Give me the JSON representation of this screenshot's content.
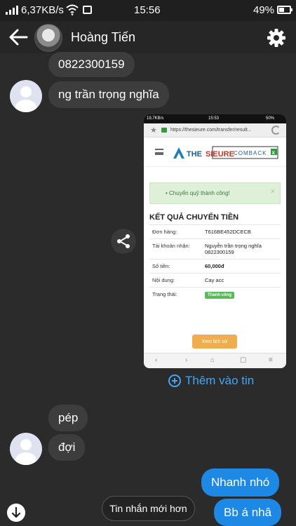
{
  "status_bar": {
    "speed": "6,37KB/s",
    "time": "15:56",
    "battery": "49%",
    "battery_level": 0.49
  },
  "header": {
    "title": "Hoàng Tiến"
  },
  "messages": [
    {
      "text": "0822300159",
      "direction": "in"
    },
    {
      "text": "ng trần trọng nghĩa",
      "direction": "in"
    },
    {
      "text": "pép",
      "direction": "in"
    },
    {
      "text": "đợi",
      "direction": "in"
    },
    {
      "text": "Nhanh nhó",
      "direction": "out"
    },
    {
      "text": "Bb á nhâ",
      "direction": "out"
    }
  ],
  "screenshot": {
    "status": {
      "speed": "19,7KB/s",
      "time": "15:53",
      "battery": "50%"
    },
    "url": "https://thesieure.com/transfer/result...",
    "logo": {
      "brand_a": "THE",
      "brand_b": "SIEURE",
      "badge": "COMBACK"
    },
    "alert": "Chuyển quỹ thành công!",
    "title": "KẾT QUẢ CHUYỂN TIỀN",
    "rows": [
      {
        "label": "Đơn hàng:",
        "value": "T616BE452DCECB"
      },
      {
        "label": "Tài khoản nhận:",
        "value": "Nguyễn trần trọng nghĩa 0822300159"
      },
      {
        "label": "Số tiền:",
        "value": "60,000đ"
      },
      {
        "label": "Nội dung:",
        "value": "Cay acc"
      },
      {
        "label": "Trạng thái:",
        "value": "Thành công"
      }
    ],
    "history_button": "Xem lịch sử"
  },
  "add_to_post": "Thêm vào tin",
  "new_messages_button": "Tin nhắn mới hơn",
  "colors": {
    "background": "#2b2b2b",
    "incoming_bubble": "#3d3d3d",
    "outgoing_bubble": "#1e88e5",
    "link": "#42a5f5"
  }
}
